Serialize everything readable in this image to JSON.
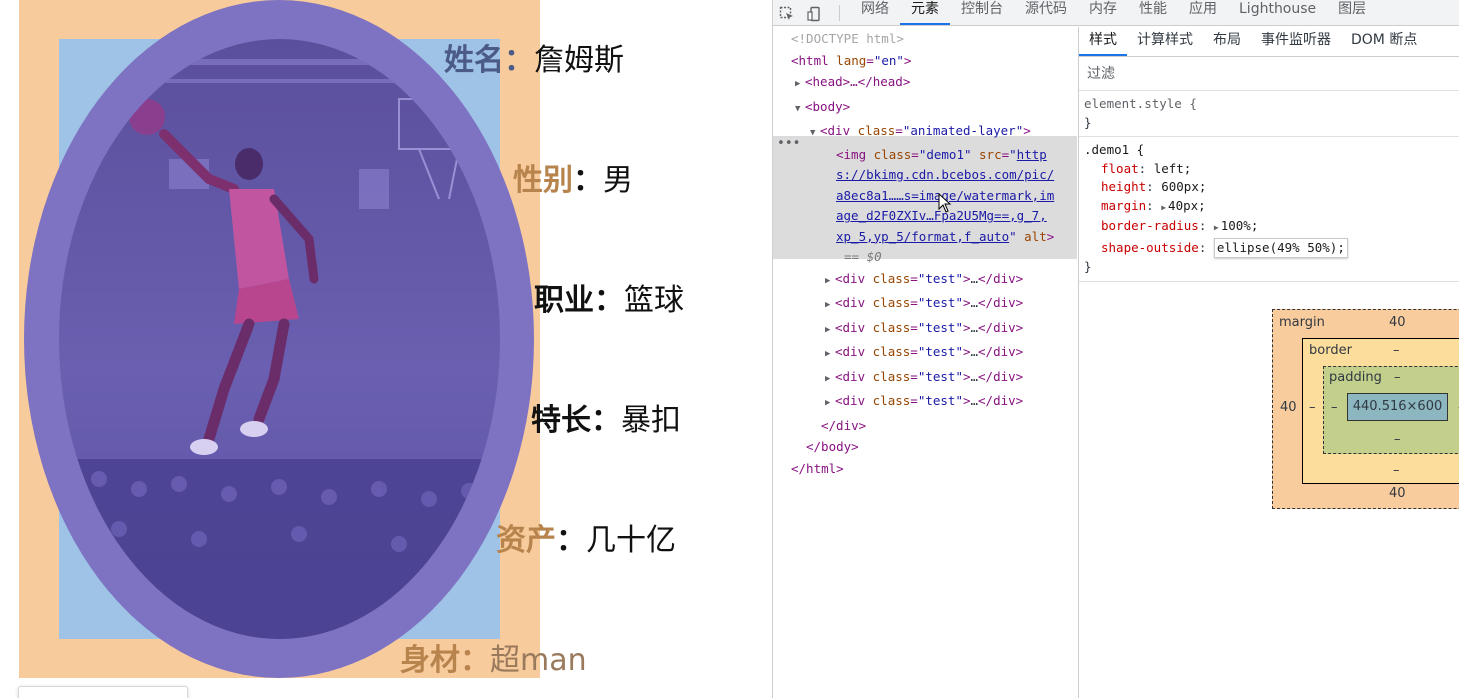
{
  "page": {
    "info": [
      {
        "key": "姓名",
        "sep": "：",
        "value": "詹姆斯"
      },
      {
        "key": "性别",
        "sep": "：",
        "value": "男"
      },
      {
        "key": "职业",
        "sep": "：",
        "value": "篮球"
      },
      {
        "key": "特长",
        "sep": "：",
        "value": "暴扣"
      },
      {
        "key": "资产",
        "sep": "：",
        "value": "几十亿"
      },
      {
        "key": "身材",
        "sep": "：",
        "value": "超man"
      }
    ],
    "colors": {
      "margin_overlay": "#f8cb9c",
      "content_overlay": "#9fc3e6",
      "shape_overlay": "#7e72c2"
    }
  },
  "devtools": {
    "toolbar_icons": [
      "inspect-icon",
      "device-toggle-icon"
    ],
    "tabs": [
      "网络",
      "元素",
      "控制台",
      "源代码",
      "内存",
      "性能",
      "应用",
      "Lighthouse",
      "图层"
    ],
    "active_tab": "元素",
    "dom": {
      "doctype": "<!DOCTYPE html>",
      "html_open": "html",
      "html_lang_attr": "lang",
      "html_lang_val": "\"en\"",
      "head_collapsed": "<head>…</head>",
      "body_open": "<body>",
      "div_open_tag": "div",
      "div_open_attr": "class",
      "div_open_val": "\"animated-layer\"",
      "img_tag": "img",
      "img_class_attr": "class",
      "img_class_val": "\"demo1\"",
      "img_src_attr": "src",
      "img_src_quote": "\"",
      "img_src_lines": [
        "http",
        "s://bkimg.cdn.bcebos.com/pic/",
        "a8ec8a1……s=image/watermark,im",
        "age_d2F0ZXIv…Fpa2U5Mg==,g_7,",
        "xp_5,yp_5/format,f_auto"
      ],
      "img_alt": "alt",
      "img_eq": "== $0",
      "child_tag": "div",
      "child_attr": "class",
      "child_val": "\"test\"",
      "child_ellipsis": "…",
      "child_count": 6,
      "div_close": "</div>",
      "body_close": "</body>",
      "html_close": "</html>"
    },
    "styles": {
      "tabs": [
        "样式",
        "计算样式",
        "布局",
        "事件监听器",
        "DOM 断点"
      ],
      "active_tab": "样式",
      "filter_placeholder": "过滤",
      "element_style_selector": "element.style {",
      "close_brace": "}",
      "rule_selector": ".demo1 {",
      "rule_props": [
        {
          "name": "float",
          "value": "left;"
        },
        {
          "name": "height",
          "value": "600px;"
        },
        {
          "name": "margin",
          "value": "40px;",
          "expandable": true
        },
        {
          "name": "border-radius",
          "value": "100%;",
          "expandable": true
        },
        {
          "name": "shape-outside",
          "value": "ellipse(49% 50%);",
          "editing": true
        }
      ]
    },
    "box_model": {
      "margin_label": "margin",
      "margin_top": "40",
      "margin_bottom": "40",
      "margin_left": "40",
      "border_label": "border",
      "border_top": "–",
      "border_bottom": "–",
      "border_left": "–",
      "padding_label": "padding",
      "padding_top": "–",
      "padding_bottom": "–",
      "padding_left": "–",
      "padding_right": "–",
      "content_size": "440.516×600"
    }
  }
}
